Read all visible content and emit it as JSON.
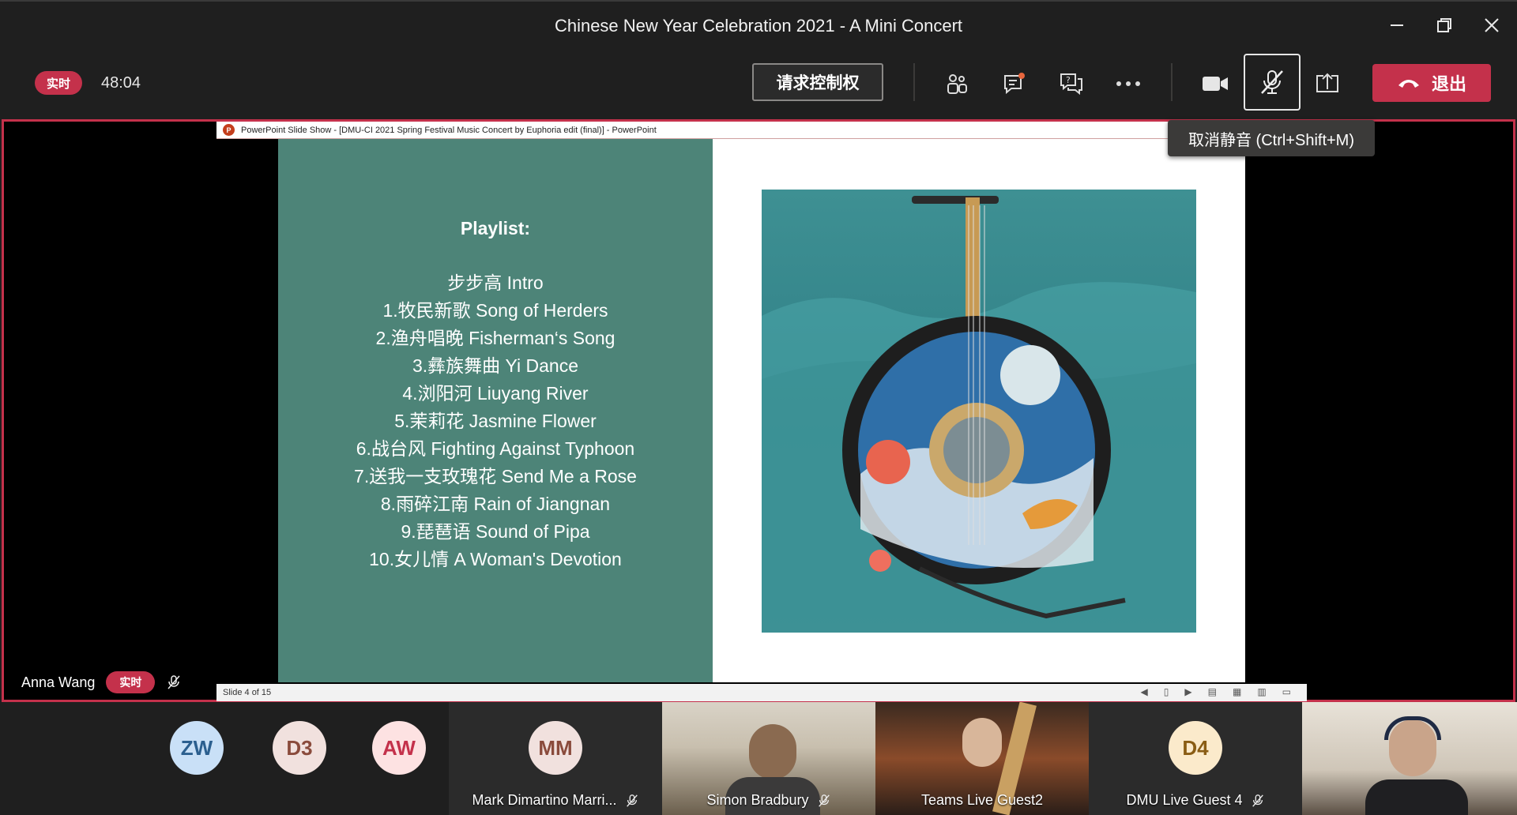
{
  "window": {
    "title": "Chinese New Year Celebration 2021 - A Mini Concert"
  },
  "toolbar": {
    "live_badge": "实时",
    "timer": "48:04",
    "request_control": "请求控制权",
    "leave_label": "退出",
    "unmute_tooltip": "取消静音 (Ctrl+Shift+M)"
  },
  "ppt": {
    "window_title": "PowerPoint Slide Show - [DMU-CI 2021 Spring Festival Music Concert by Euphoria edit (final)] - PowerPoint",
    "status": "Slide 4 of 15",
    "slide": {
      "heading": "Playlist:",
      "items": [
        "步步高 Intro",
        "1.牧民新歌 Song of Herders",
        "2.渔舟唱晚 Fisherman‘s Song",
        "3.彝族舞曲 Yi Dance",
        "4.浏阳河 Liuyang River",
        "5.茉莉花 Jasmine Flower",
        "6.战台风 Fighting Against Typhoon",
        "7.送我一支玫瑰花 Send Me a Rose",
        "8.雨碎江南 Rain of Jiangnan",
        "9.琵琶语 Sound of Pipa",
        "10.女儿情 A Woman's Devotion"
      ]
    }
  },
  "presenter": {
    "name": "Anna Wang",
    "badge": "实时"
  },
  "participants": [
    {
      "initials": "ZW",
      "color": "#c9e0f7",
      "text_color": "#2b5f8f"
    },
    {
      "initials": "D3",
      "color": "#f1e1de",
      "text_color": "#8a4b3c"
    },
    {
      "initials": "AW",
      "color": "#fde2e2",
      "text_color": "#c4314b"
    },
    {
      "initials": "MM",
      "name": "Mark Dimartino Marri...",
      "color": "#f1e1de",
      "text_color": "#8a4b3c"
    },
    {
      "name": "Simon Bradbury"
    },
    {
      "name": "Teams Live Guest2"
    },
    {
      "initials": "D4",
      "name": "DMU Live Guest 4",
      "color": "#fbeacb",
      "text_color": "#8a5d14"
    },
    {
      "name": ""
    }
  ],
  "colors": {
    "accent_red": "#c4314b",
    "slide_green": "#4d8478"
  }
}
